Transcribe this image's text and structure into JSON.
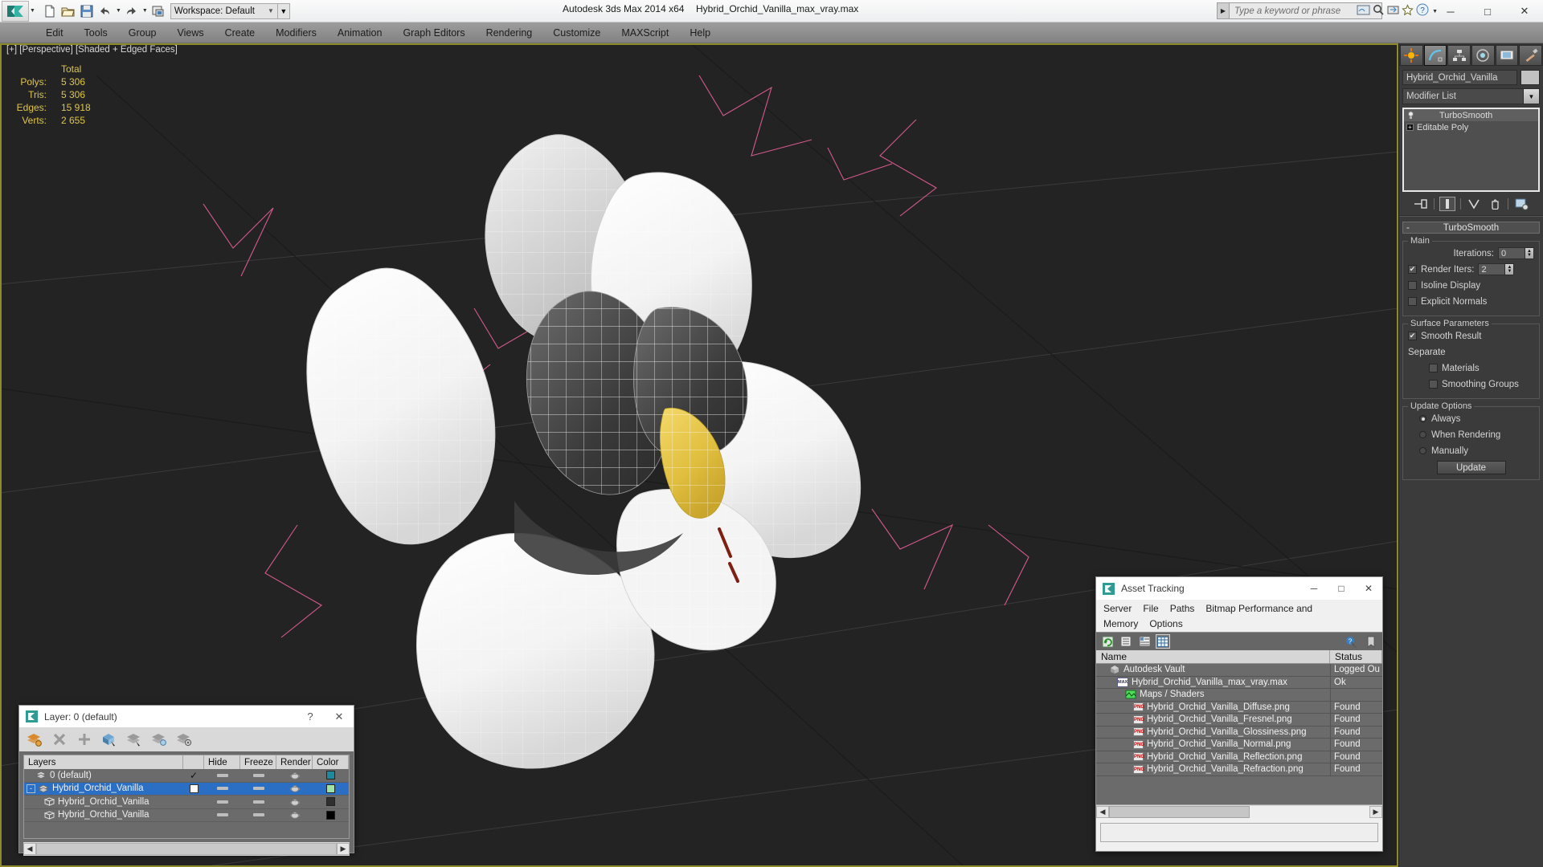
{
  "titlebar": {
    "workspace": "Workspace: Default",
    "app_title": "Autodesk 3ds Max  2014 x64",
    "file_title": "Hybrid_Orchid_Vanilla_max_vray.max",
    "search_placeholder": "Type a keyword or phrase",
    "quick_access": [
      "new-file-icon",
      "open-file-icon",
      "save-file-icon",
      "undo-icon",
      "redo-icon",
      "project-folder-icon"
    ],
    "window_buttons": {
      "minimize": "─",
      "maximize": "□",
      "close": "✕"
    }
  },
  "menubar": {
    "items": [
      "Edit",
      "Tools",
      "Group",
      "Views",
      "Create",
      "Modifiers",
      "Animation",
      "Graph Editors",
      "Rendering",
      "Customize",
      "MAXScript",
      "Help"
    ]
  },
  "viewport": {
    "label": "[+] [Perspective] [Shaded + Edged Faces]",
    "stats": {
      "header": "Total",
      "rows": [
        {
          "label": "Polys:",
          "value": "5 306"
        },
        {
          "label": "Tris:",
          "value": "5 306"
        },
        {
          "label": "Edges:",
          "value": "15 918"
        },
        {
          "label": "Verts:",
          "value": "2 655"
        }
      ]
    },
    "colors": {
      "background": "#232323",
      "stats_text": "#e0c54a",
      "gizmo_pink": "#d6598f",
      "border": "#8f8a2b"
    }
  },
  "command_panel": {
    "tabs": [
      "create-tab",
      "modify-tab",
      "hierarchy-tab",
      "motion-tab",
      "display-tab",
      "utilities-tab"
    ],
    "selected_tab_index": 1,
    "object_name": "Hybrid_Orchid_Vanilla",
    "modifier_list_label": "Modifier List",
    "stack": [
      {
        "label": "TurboSmooth",
        "selected": true
      },
      {
        "label": "Editable Poly",
        "selected": false
      }
    ],
    "rollout": {
      "title": "TurboSmooth",
      "collapse_glyph": "-",
      "main": {
        "title": "Main",
        "iterations_label": "Iterations:",
        "iterations_value": "0",
        "render_iters_label": "Render Iters:",
        "render_iters_value": "2",
        "render_iters_checked": true,
        "isoline_display_label": "Isoline Display",
        "isoline_display_checked": false,
        "explicit_normals_label": "Explicit Normals",
        "explicit_normals_checked": false
      },
      "surface": {
        "title": "Surface Parameters",
        "smooth_result_label": "Smooth Result",
        "smooth_result_checked": true,
        "separate_label": "Separate",
        "materials_label": "Materials",
        "materials_checked": false,
        "smoothing_groups_label": "Smoothing Groups",
        "smoothing_groups_checked": false
      },
      "update": {
        "title": "Update Options",
        "options": [
          "Always",
          "When Rendering",
          "Manually"
        ],
        "selected_index": 0,
        "button_label": "Update"
      }
    }
  },
  "asset_tracking": {
    "title": "Asset Tracking",
    "menu": [
      "Server",
      "File",
      "Paths",
      "Bitmap Performance and Memory",
      "Options"
    ],
    "window_buttons": {
      "minimize": "─",
      "maximize": "□",
      "close": "✕"
    },
    "toolbar_icons": [
      "refresh-icon",
      "list-view-icon",
      "details-view-icon",
      "grid-view-icon"
    ],
    "toolbar_right_icons": [
      "help-pointer-icon",
      "bookmark-icon"
    ],
    "columns": [
      "Name",
      "Status"
    ],
    "rows": [
      {
        "name": "Autodesk Vault",
        "status": "Logged Ou",
        "icon": "vault-icon",
        "indent": 1
      },
      {
        "name": "Hybrid_Orchid_Vanilla_max_vray.max",
        "status": "Ok",
        "icon": "max-file-icon",
        "indent": 2
      },
      {
        "name": "Maps / Shaders",
        "status": "",
        "icon": "maps-icon",
        "indent": 3
      },
      {
        "name": "Hybrid_Orchid_Vanilla_Diffuse.png",
        "status": "Found",
        "icon": "png-icon",
        "indent": 4
      },
      {
        "name": "Hybrid_Orchid_Vanilla_Fresnel.png",
        "status": "Found",
        "icon": "png-icon",
        "indent": 4
      },
      {
        "name": "Hybrid_Orchid_Vanilla_Glossiness.png",
        "status": "Found",
        "icon": "png-icon",
        "indent": 4
      },
      {
        "name": "Hybrid_Orchid_Vanilla_Normal.png",
        "status": "Found",
        "icon": "png-icon",
        "indent": 4
      },
      {
        "name": "Hybrid_Orchid_Vanilla_Reflection.png",
        "status": "Found",
        "icon": "png-icon",
        "indent": 4
      },
      {
        "name": "Hybrid_Orchid_Vanilla_Refraction.png",
        "status": "Found",
        "icon": "png-icon",
        "indent": 4
      }
    ]
  },
  "layer_dialog": {
    "title": "Layer: 0 (default)",
    "help_glyph": "?",
    "close_glyph": "✕",
    "tools": [
      "new-layer-icon",
      "delete-layer-icon",
      "add-layer-icon",
      "select-objects-icon",
      "select-highlighted-icon",
      "highlight-selected-icon",
      "layer-properties-icon"
    ],
    "columns": [
      "Layers",
      "",
      "Hide",
      "Freeze",
      "Render",
      "Color"
    ],
    "rows": [
      {
        "name": "0 (default)",
        "icon": "layer-stack-icon",
        "indent": 1,
        "selected": false,
        "check": "✓",
        "color": "#1a8a9c",
        "expand": ""
      },
      {
        "name": "Hybrid_Orchid_Vanilla",
        "icon": "layer-stack-icon",
        "indent": 0,
        "selected": true,
        "check": "",
        "color": "#9ce3a8",
        "expand": "-"
      },
      {
        "name": "Hybrid_Orchid_Vanilla",
        "icon": "object-cube-icon",
        "indent": 2,
        "selected": false,
        "check": "",
        "color": "#2f2f2f",
        "expand": ""
      },
      {
        "name": "Hybrid_Orchid_Vanilla",
        "icon": "object-cube-icon",
        "indent": 2,
        "selected": false,
        "check": "",
        "color": "#000000",
        "expand": ""
      }
    ]
  }
}
